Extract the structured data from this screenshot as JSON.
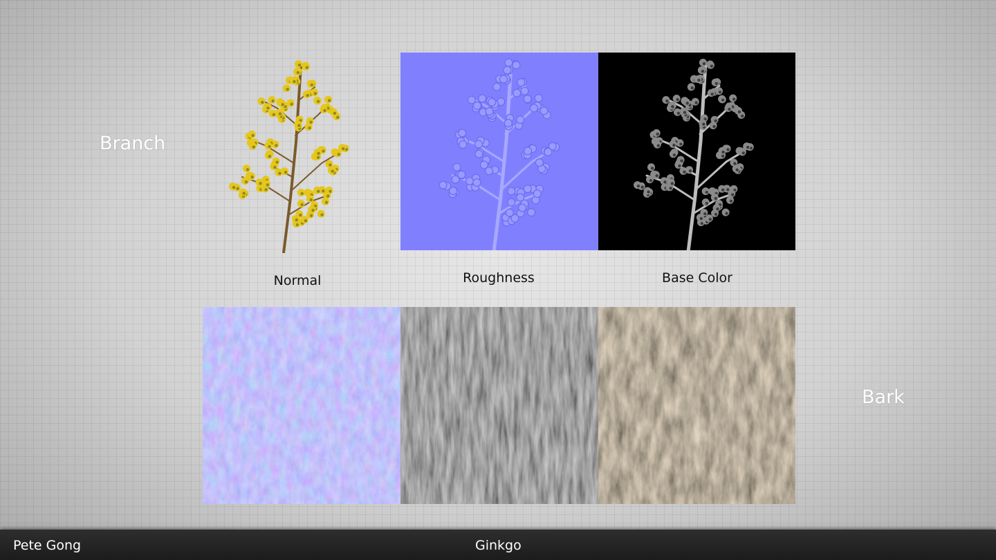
{
  "slide": {
    "section_branch": "Branch",
    "section_bark": "Bark",
    "captions": {
      "normal": "Normal",
      "roughness": "Roughness",
      "base_color": "Base Color"
    }
  },
  "footer": {
    "author": "Pete Gong",
    "title": "Ginkgo"
  },
  "colors": {
    "normal_map": "#8080ff",
    "footer_bg": "#222222",
    "branch_yellow": "#e6c61a",
    "bark_brown": "#6b5a44"
  }
}
